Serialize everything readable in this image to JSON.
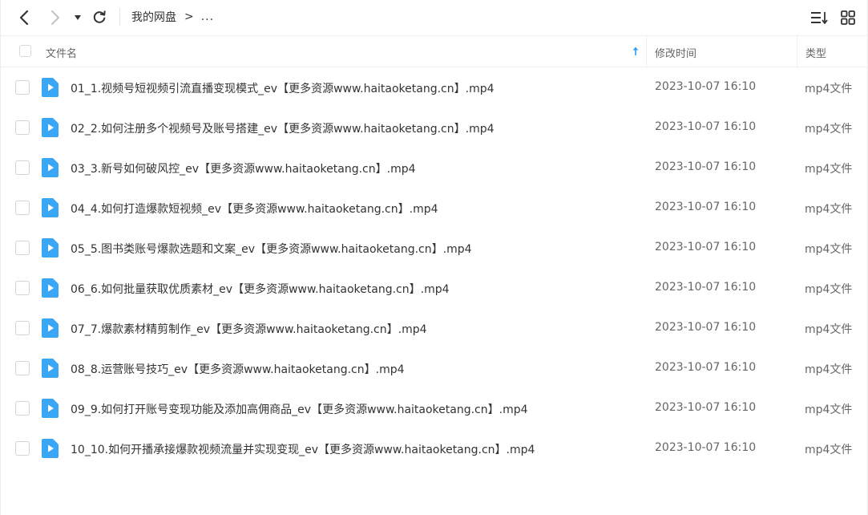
{
  "breadcrumb": {
    "root": "我的网盘",
    "separator": ">",
    "more": "..."
  },
  "header": {
    "name": "文件名",
    "modified": "修改时间",
    "type": "类型"
  },
  "colors": {
    "accent": "#2d9cf4",
    "icon": "#3aa7f6"
  },
  "files": [
    {
      "name": "01_1.视频号短视频引流直播变现模式_ev【更多资源www.haitaoketang.cn】.mp4",
      "modified": "2023-10-07 16:10",
      "type": "mp4文件"
    },
    {
      "name": "02_2.如何注册多个视频号及账号搭建_ev【更多资源www.haitaoketang.cn】.mp4",
      "modified": "2023-10-07 16:10",
      "type": "mp4文件"
    },
    {
      "name": "03_3.新号如何破风控_ev【更多资源www.haitaoketang.cn】.mp4",
      "modified": "2023-10-07 16:10",
      "type": "mp4文件"
    },
    {
      "name": "04_4.如何打造爆款短视频_ev【更多资源www.haitaoketang.cn】.mp4",
      "modified": "2023-10-07 16:10",
      "type": "mp4文件"
    },
    {
      "name": "05_5.图书类账号爆款选题和文案_ev【更多资源www.haitaoketang.cn】.mp4",
      "modified": "2023-10-07 16:10",
      "type": "mp4文件"
    },
    {
      "name": "06_6.如何批量获取优质素材_ev【更多资源www.haitaoketang.cn】.mp4",
      "modified": "2023-10-07 16:10",
      "type": "mp4文件"
    },
    {
      "name": "07_7.爆款素材精剪制作_ev【更多资源www.haitaoketang.cn】.mp4",
      "modified": "2023-10-07 16:10",
      "type": "mp4文件"
    },
    {
      "name": "08_8.运营账号技巧_ev【更多资源www.haitaoketang.cn】.mp4",
      "modified": "2023-10-07 16:10",
      "type": "mp4文件"
    },
    {
      "name": "09_9.如何打开账号变现功能及添加高佣商品_ev【更多资源www.haitaoketang.cn】.mp4",
      "modified": "2023-10-07 16:10",
      "type": "mp4文件"
    },
    {
      "name": "10_10.如何开播承接爆款视频流量并实现变现_ev【更多资源www.haitaoketang.cn】.mp4",
      "modified": "2023-10-07 16:10",
      "type": "mp4文件"
    }
  ]
}
